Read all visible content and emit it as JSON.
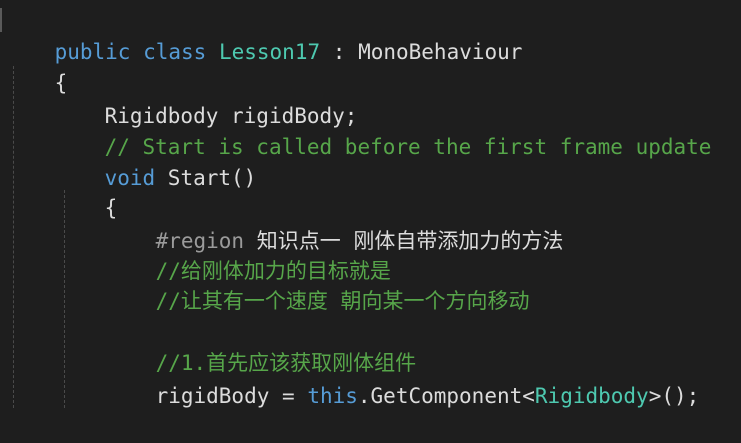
{
  "code": {
    "line1": {
      "kw_public": "public",
      "kw_class": "class",
      "class_name": "Lesson17",
      "colon": " : ",
      "base": "MonoBehaviour"
    },
    "line2": {
      "brace": "{"
    },
    "line3": {
      "type": "Rigidbody",
      "rest": " rigidBody;"
    },
    "line4": {
      "comment": "// Start is called before the first frame update"
    },
    "line5": {
      "kw_void": "void",
      "method": " Start()"
    },
    "line6": {
      "brace": "{"
    },
    "line7": {
      "directive": "#region",
      "text": " 知识点一 刚体自带添加力的方法"
    },
    "line8": {
      "comment": "//给刚体加力的目标就是"
    },
    "line9": {
      "comment": "//让其有一个速度 朝向某一个方向移动"
    },
    "line10": {
      "comment": "//1.首先应该获取刚体组件"
    },
    "line11": {
      "var": "rigidBody",
      "eq": " = ",
      "kw_this": "this",
      "call": ".GetComponent<",
      "type": "Rigidbody",
      "end": ">();"
    }
  }
}
